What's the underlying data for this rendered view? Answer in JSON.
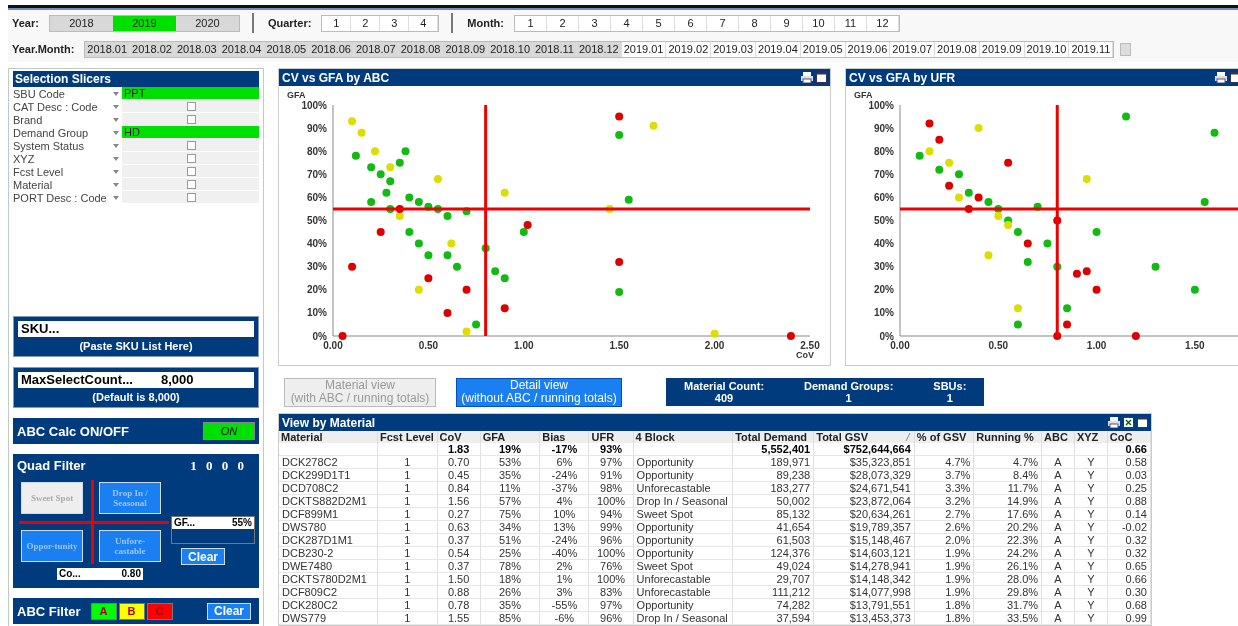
{
  "filters": {
    "year": {
      "label": "Year:",
      "items": [
        {
          "label": "2018",
          "selected": false
        },
        {
          "label": "2019",
          "selected": true
        },
        {
          "label": "2020",
          "selected": false
        }
      ]
    },
    "quarter": {
      "label": "Quarter:",
      "items": [
        "1",
        "2",
        "3",
        "4"
      ]
    },
    "month": {
      "label": "Month:",
      "items": [
        "1",
        "2",
        "3",
        "4",
        "5",
        "6",
        "7",
        "8",
        "9",
        "10",
        "11",
        "12"
      ]
    },
    "year_month": {
      "label": "Year.Month:",
      "items": [
        {
          "label": "2018.01",
          "excluded": true
        },
        {
          "label": "2018.02",
          "excluded": true
        },
        {
          "label": "2018.03",
          "excluded": true
        },
        {
          "label": "2018.04",
          "excluded": true
        },
        {
          "label": "2018.05",
          "excluded": true
        },
        {
          "label": "2018.06",
          "excluded": true
        },
        {
          "label": "2018.07",
          "excluded": true
        },
        {
          "label": "2018.08",
          "excluded": true
        },
        {
          "label": "2018.09",
          "excluded": true
        },
        {
          "label": "2018.10",
          "excluded": true
        },
        {
          "label": "2018.11",
          "excluded": true
        },
        {
          "label": "2018.12",
          "excluded": true
        },
        {
          "label": "2019.01",
          "excluded": false
        },
        {
          "label": "2019.02",
          "excluded": false
        },
        {
          "label": "2019.03",
          "excluded": false
        },
        {
          "label": "2019.04",
          "excluded": false
        },
        {
          "label": "2019.05",
          "excluded": false
        },
        {
          "label": "2019.06",
          "excluded": false
        },
        {
          "label": "2019.07",
          "excluded": false
        },
        {
          "label": "2019.08",
          "excluded": false
        },
        {
          "label": "2019.09",
          "excluded": false
        },
        {
          "label": "2019.10",
          "excluded": false
        },
        {
          "label": "2019.11",
          "excluded": false
        }
      ]
    }
  },
  "slicers": {
    "title": "Selection Slicers",
    "items": [
      {
        "label": "SBU Code",
        "kind": "value",
        "value": "PPT"
      },
      {
        "label": "CAT Desc : Code",
        "kind": "checkbox",
        "checked": false
      },
      {
        "label": "Brand",
        "kind": "checkbox",
        "checked": false
      },
      {
        "label": "Demand Group",
        "kind": "value",
        "value": "HD"
      },
      {
        "label": "System Status",
        "kind": "checkbox",
        "checked": false
      },
      {
        "label": "XYZ",
        "kind": "checkbox",
        "checked": false
      },
      {
        "label": "Fcst Level",
        "kind": "checkbox",
        "checked": false
      },
      {
        "label": "Material",
        "kind": "checkbox",
        "checked": false
      },
      {
        "label": "PORT Desc : Code",
        "kind": "checkbox",
        "checked": false
      }
    ]
  },
  "sku": {
    "value": "SKU...",
    "note": "(Paste SKU List Here)"
  },
  "max_select": {
    "label": "MaxSelectCount...",
    "value": "8,000",
    "note": "(Default is 8,000)"
  },
  "abc_calc": {
    "label": "ABC Calc ON/OFF",
    "button": "ON",
    "on": true
  },
  "quad_filter": {
    "title": "Quad Filter",
    "code": "1 0 0 0",
    "buttons": [
      {
        "label": "Sweet Spot",
        "selected": true
      },
      {
        "label": "Drop In / Seasonal",
        "selected": false
      },
      {
        "label": "Oppor-tunity",
        "selected": false
      },
      {
        "label": "Unfore-castable",
        "selected": false
      }
    ],
    "gfa": {
      "label": "GF...",
      "value": "55%"
    },
    "cov": {
      "label": "Co...",
      "value": "0.80"
    },
    "clear": "Clear"
  },
  "abc_filter": {
    "title": "ABC Filter",
    "buttons": [
      {
        "label": "A",
        "color": "#00ff00"
      },
      {
        "label": "B",
        "color": "#ffff00"
      },
      {
        "label": "C",
        "color": "#ff0000"
      }
    ],
    "clear": "Clear"
  },
  "charts": [
    {
      "title": "CV vs GFA by ABC",
      "chart_data": {
        "type": "scatter",
        "xlabel": "CoV",
        "ylabel": "GFA",
        "xlim": [
          0,
          2.5
        ],
        "ylim": [
          0,
          100
        ],
        "xticks": [
          {
            "value": 0,
            "label": "0.00"
          },
          {
            "value": 0.5,
            "label": "0.50"
          },
          {
            "value": 1,
            "label": "1.00"
          },
          {
            "value": 1.5,
            "label": "1.50"
          },
          {
            "value": 2,
            "label": "2.00"
          },
          {
            "value": 2.5,
            "label": "2.50"
          }
        ],
        "yticks": [
          {
            "value": 0,
            "label": "0%"
          },
          {
            "value": 10,
            "label": "10%"
          },
          {
            "value": 20,
            "label": "20%"
          },
          {
            "value": 30,
            "label": "30%"
          },
          {
            "value": 40,
            "label": "40%"
          },
          {
            "value": 50,
            "label": "50%"
          },
          {
            "value": 60,
            "label": "60%"
          },
          {
            "value": 70,
            "label": "70%"
          },
          {
            "value": 80,
            "label": "80%"
          },
          {
            "value": 90,
            "label": "90%"
          },
          {
            "value": 100,
            "label": "100%"
          }
        ],
        "series": [
          {
            "color": "#11bb11",
            "x": [
              0.12,
              0.2,
              0.25,
              0.28,
              0.3,
              0.35,
              0.38,
              0.4,
              0.45,
              0.5,
              0.55,
              0.6,
              0.7,
              0.4,
              0.45,
              0.5,
              0.6,
              0.65,
              0.8,
              0.85,
              0.9,
              1.0,
              1.5,
              1.55,
              1.5,
              0.75,
              0.3,
              0.2
            ],
            "values": [
              78,
              73,
              70,
              62,
              67,
              75,
              80,
              60,
              58,
              56,
              55,
              52,
              54,
              45,
              40,
              35,
              35,
              30,
              38,
              28,
              25,
              45,
              87,
              59,
              19,
              5,
              55,
              58
            ]
          },
          {
            "color": "#dddd00",
            "x": [
              0.1,
              0.15,
              0.22,
              0.3,
              0.55,
              0.62,
              0.9,
              1.45,
              1.68,
              0.7,
              2.0,
              0.45,
              0.35
            ],
            "values": [
              93,
              88,
              80,
              73,
              68,
              40,
              62,
              55,
              91,
              2,
              1,
              20,
              52
            ]
          },
          {
            "color": "#dd0000",
            "x": [
              0.1,
              0.25,
              0.35,
              0.5,
              0.6,
              1.02,
              1.5,
              1.5,
              0.05,
              2.4,
              0.9,
              0.7
            ],
            "values": [
              30,
              45,
              55,
              25,
              10,
              48,
              32,
              95,
              0,
              0,
              12,
              20
            ]
          }
        ],
        "ref_lines": [
          {
            "axis": "x",
            "value": 0.8
          },
          {
            "axis": "y",
            "value": 55
          }
        ]
      }
    },
    {
      "title": "CV vs GFA by UFR",
      "chart_data": {
        "type": "scatter",
        "ylabel": "GFA",
        "xlim": [
          0,
          1.75
        ],
        "ylim": [
          0,
          100
        ],
        "xticks": [
          {
            "value": 0,
            "label": "0.00"
          },
          {
            "value": 0.5,
            "label": "0.50"
          },
          {
            "value": 1,
            "label": "1.00"
          },
          {
            "value": 1.5,
            "label": "1.50"
          }
        ],
        "yticks": [
          {
            "value": 0,
            "label": "0%"
          },
          {
            "value": 10,
            "label": "10%"
          },
          {
            "value": 20,
            "label": "20%"
          },
          {
            "value": 30,
            "label": "30%"
          },
          {
            "value": 40,
            "label": "40%"
          },
          {
            "value": 50,
            "label": "50%"
          },
          {
            "value": 60,
            "label": "60%"
          },
          {
            "value": 70,
            "label": "70%"
          },
          {
            "value": 80,
            "label": "80%"
          },
          {
            "value": 90,
            "label": "90%"
          },
          {
            "value": 100,
            "label": "100%"
          }
        ],
        "series": [
          {
            "color": "#11bb11",
            "x": [
              0.1,
              0.2,
              0.3,
              0.35,
              0.45,
              0.5,
              0.55,
              0.6,
              0.7,
              0.75,
              0.8,
              0.85,
              0.65,
              0.6,
              1.15,
              1.55,
              1.5,
              1.3,
              1.6,
              1.0
            ],
            "values": [
              78,
              72,
              70,
              62,
              58,
              55,
              50,
              45,
              56,
              40,
              30,
              12,
              32,
              5,
              95,
              58,
              20,
              30,
              88,
              45
            ]
          },
          {
            "color": "#dddd00",
            "x": [
              0.15,
              0.25,
              0.3,
              0.45,
              0.5,
              0.55,
              0.6,
              0.95,
              0.4
            ],
            "values": [
              80,
              75,
              60,
              35,
              52,
              48,
              12,
              68,
              90
            ]
          },
          {
            "color": "#dd0000",
            "x": [
              0.15,
              0.2,
              0.25,
              0.35,
              0.4,
              0.65,
              0.8,
              0.9,
              0.95,
              0.8,
              0.85,
              1.2,
              0.55,
              1.0
            ],
            "values": [
              92,
              85,
              65,
              55,
              60,
              40,
              50,
              27,
              28,
              0,
              5,
              0,
              75,
              20
            ]
          }
        ],
        "ref_lines": [
          {
            "axis": "x",
            "value": 0.8
          },
          {
            "axis": "y",
            "value": 55
          }
        ]
      }
    }
  ],
  "view_buttons": [
    {
      "lines": [
        "Material view",
        "(with ABC / running totals)"
      ],
      "selected": false
    },
    {
      "lines": [
        "Detail view",
        "(without ABC / running totals)"
      ],
      "selected": true
    }
  ],
  "stats": [
    {
      "label": "Material Count:",
      "value": "409"
    },
    {
      "label": "Demand Groups:",
      "value": "1"
    },
    {
      "label": "SBUs:",
      "value": "1"
    }
  ],
  "table": {
    "title": "View by Material",
    "columns": [
      {
        "label": "Material",
        "sorted": false
      },
      {
        "label": "Fcst Level",
        "sorted": false
      },
      {
        "label": "CoV",
        "sorted": false,
        "total": "1.83"
      },
      {
        "label": "GFA",
        "sorted": false,
        "total": "19%"
      },
      {
        "label": "Bias",
        "sorted": false,
        "total": "-17%"
      },
      {
        "label": "UFR",
        "sorted": false,
        "total": "93%"
      },
      {
        "label": "4 Block",
        "sorted": false
      },
      {
        "label": "Total Demand",
        "sorted": false,
        "total": "5,552,401"
      },
      {
        "label": "Total GSV",
        "sorted": true,
        "total": "$752,644,664"
      },
      {
        "label": "% of GSV",
        "sorted": false
      },
      {
        "label": "Running %",
        "sorted": false
      },
      {
        "label": "ABC",
        "sorted": false
      },
      {
        "label": "XYZ",
        "sorted": false
      },
      {
        "label": "CoC",
        "sorted": false,
        "total": "0.66"
      }
    ],
    "rows": [
      [
        "DCK278C2",
        "1",
        "0.70",
        "53%",
        "6%",
        "97%",
        "Opportunity",
        "189,971",
        "$35,323,851",
        "4.7%",
        "4.7%",
        "A",
        "Y",
        "0.58"
      ],
      [
        "DCK299D1T1",
        "1",
        "0.45",
        "35%",
        "-24%",
        "91%",
        "Opportunity",
        "89,238",
        "$28,073,329",
        "3.7%",
        "8.4%",
        "A",
        "Y",
        "0.03"
      ],
      [
        "DCD708C2",
        "1",
        "0.84",
        "11%",
        "-37%",
        "98%",
        "Unforecastable",
        "183,277",
        "$24,671,541",
        "3.3%",
        "11.7%",
        "A",
        "Y",
        "0.25"
      ],
      [
        "DCKTS882D2M1",
        "1",
        "1.56",
        "57%",
        "4%",
        "100%",
        "Drop In / Seasonal",
        "50,002",
        "$23,872,064",
        "3.2%",
        "14.9%",
        "A",
        "Y",
        "0.88"
      ],
      [
        "DCF899M1",
        "1",
        "0.27",
        "75%",
        "10%",
        "94%",
        "Sweet Spot",
        "85,132",
        "$20,634,261",
        "2.7%",
        "17.6%",
        "A",
        "Y",
        "0.14"
      ],
      [
        "DWS780",
        "1",
        "0.63",
        "34%",
        "13%",
        "99%",
        "Opportunity",
        "41,654",
        "$19,789,357",
        "2.6%",
        "20.2%",
        "A",
        "Y",
        "-0.02"
      ],
      [
        "DCK287D1M1",
        "1",
        "0.37",
        "51%",
        "-24%",
        "96%",
        "Opportunity",
        "61,503",
        "$15,148,467",
        "2.0%",
        "22.3%",
        "A",
        "Y",
        "0.32"
      ],
      [
        "DCB230-2",
        "1",
        "0.54",
        "25%",
        "-40%",
        "100%",
        "Opportunity",
        "124,376",
        "$14,603,121",
        "1.9%",
        "24.2%",
        "A",
        "Y",
        "0.32"
      ],
      [
        "DWE7480",
        "1",
        "0.37",
        "78%",
        "2%",
        "76%",
        "Sweet Spot",
        "49,024",
        "$14,278,941",
        "1.9%",
        "26.1%",
        "A",
        "Y",
        "0.65"
      ],
      [
        "DCKTS780D2M1",
        "1",
        "1.50",
        "18%",
        "1%",
        "100%",
        "Unforecastable",
        "29,707",
        "$14,148,342",
        "1.9%",
        "28.0%",
        "A",
        "Y",
        "0.66"
      ],
      [
        "DCF809C2",
        "1",
        "0.88",
        "26%",
        "3%",
        "83%",
        "Unforecastable",
        "111,212",
        "$14,077,998",
        "1.9%",
        "29.8%",
        "A",
        "Y",
        "0.30"
      ],
      [
        "DCK280C2",
        "1",
        "0.78",
        "35%",
        "-55%",
        "97%",
        "Opportunity",
        "74,282",
        "$13,791,551",
        "1.8%",
        "31.7%",
        "A",
        "Y",
        "0.68"
      ],
      [
        "DWS779",
        "1",
        "1.55",
        "85%",
        "-6%",
        "96%",
        "Drop In / Seasonal",
        "37,594",
        "$13,453,373",
        "1.8%",
        "33.5%",
        "A",
        "Y",
        "0.99"
      ]
    ]
  }
}
